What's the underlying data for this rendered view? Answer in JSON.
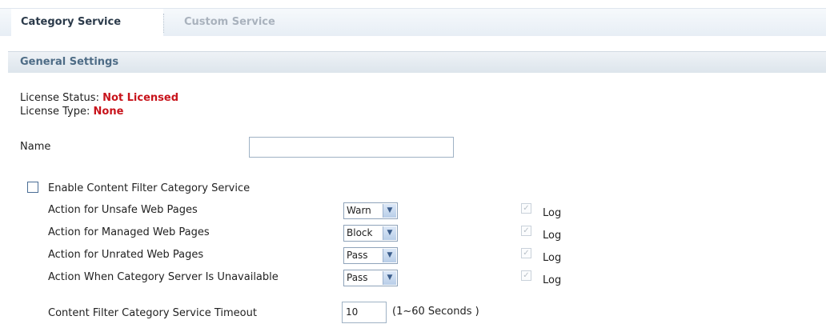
{
  "tabs": [
    {
      "label": "Category Service",
      "active": true
    },
    {
      "label": "Custom Service",
      "active": false
    }
  ],
  "section": {
    "title": "General Settings"
  },
  "license": {
    "status_label": "License Status:",
    "status_value": "Not Licensed",
    "type_label": "License Type:",
    "type_value": "None"
  },
  "name_field": {
    "label": "Name",
    "value": ""
  },
  "enable": {
    "label": "Enable Content Filter Category Service",
    "checked": false
  },
  "actions": [
    {
      "label": "Action for Unsafe Web Pages",
      "value": "Warn",
      "log": "Log"
    },
    {
      "label": "Action for Managed Web Pages",
      "value": "Block",
      "log": "Log"
    },
    {
      "label": "Action for Unrated Web Pages",
      "value": "Pass",
      "log": "Log"
    },
    {
      "label": "Action When Category Server Is Unavailable",
      "value": "Pass",
      "log": "Log"
    }
  ],
  "timeout": {
    "label": "Content Filter Category Service Timeout",
    "value": "10",
    "hint": "(1~60 Seconds )"
  },
  "colors": {
    "alert": "#c8141c",
    "section_title": "#4e6c86",
    "tab_inactive": "#a9b2bd"
  },
  "icons": {
    "dropdown": "chevron-down-icon",
    "checkmark": "check-icon"
  }
}
